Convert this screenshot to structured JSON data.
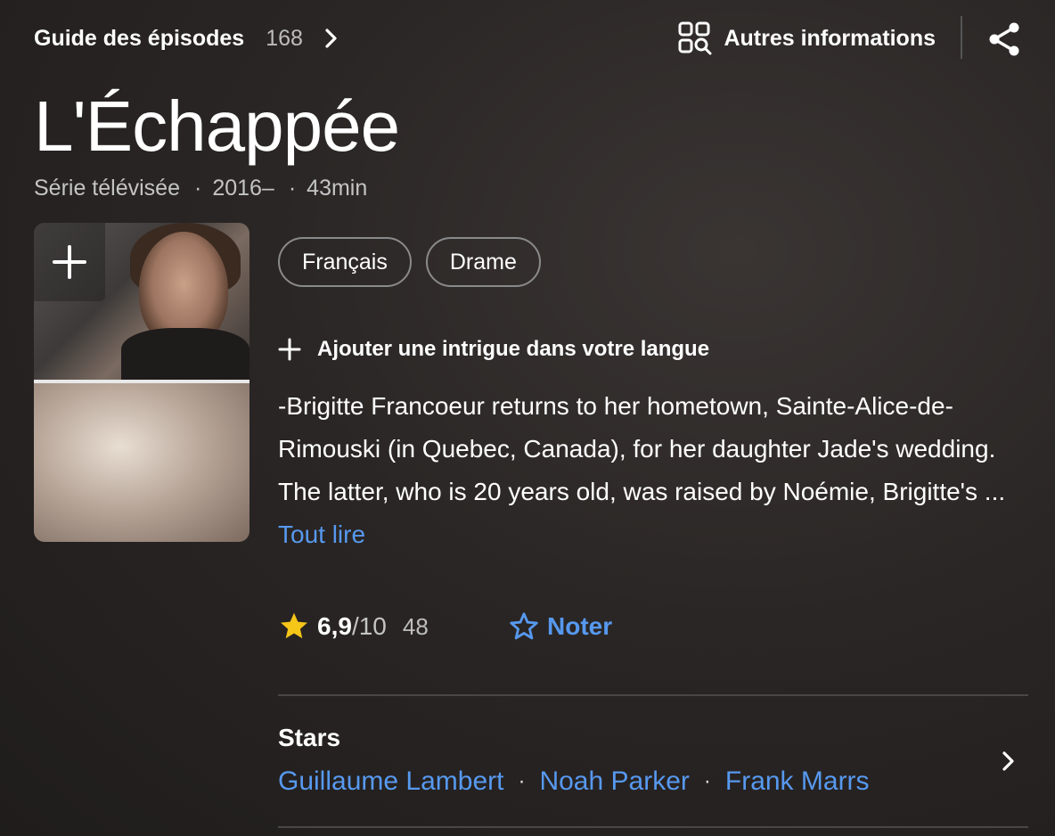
{
  "header": {
    "episode_guide_label": "Guide des épisodes",
    "episode_count": "168",
    "more_info_label": "Autres informations"
  },
  "title": "L'Échappée",
  "meta": {
    "type": "Série télévisée",
    "years": "2016–",
    "runtime": "43min"
  },
  "genres": [
    "Français",
    "Drame"
  ],
  "add_plot_label": "Ajouter une intrigue dans votre langue",
  "plot": {
    "text": "-Brigitte Francoeur returns to her hometown, Sainte-Alice-de-Rimouski (in Quebec, Canada), for her daughter Jade's wedding. The latter, who is 20 years old, was raised by Noémie, Brigitte's ...",
    "read_more": "Tout lire"
  },
  "rating": {
    "score": "6,9",
    "out_of": "/10",
    "votes": "48",
    "rate_label": "Noter"
  },
  "stars": {
    "title": "Stars",
    "names": [
      "Guillaume Lambert",
      "Noah Parker",
      "Frank Marrs"
    ]
  },
  "colors": {
    "accent_link": "#5799ef",
    "star": "#f5c518",
    "background": "#262222"
  },
  "icons": [
    "chevron-right-icon",
    "grid-search-icon",
    "share-icon",
    "plus-icon",
    "star-filled-icon",
    "star-outline-icon"
  ]
}
